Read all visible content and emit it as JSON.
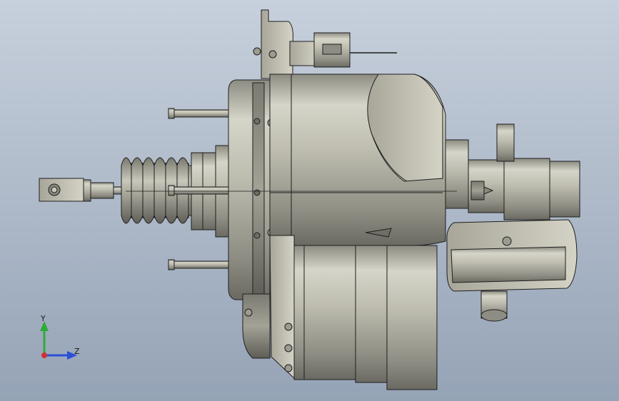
{
  "viewport": {
    "background_top": "#c7d0dc",
    "background_bottom": "#95a3b6"
  },
  "model": {
    "description_icon": "brake-booster-assembly-icon",
    "edge_color": "#1e1e1e",
    "metal_light": "#d9d8cc",
    "metal_mid": "#aeac9f",
    "metal_dark": "#6f6e66"
  },
  "triad": {
    "y_label": "Y",
    "z_label": "Z",
    "y_color": "#2faa3a",
    "z_color": "#2b4fd8",
    "x_color": "#d23030"
  }
}
